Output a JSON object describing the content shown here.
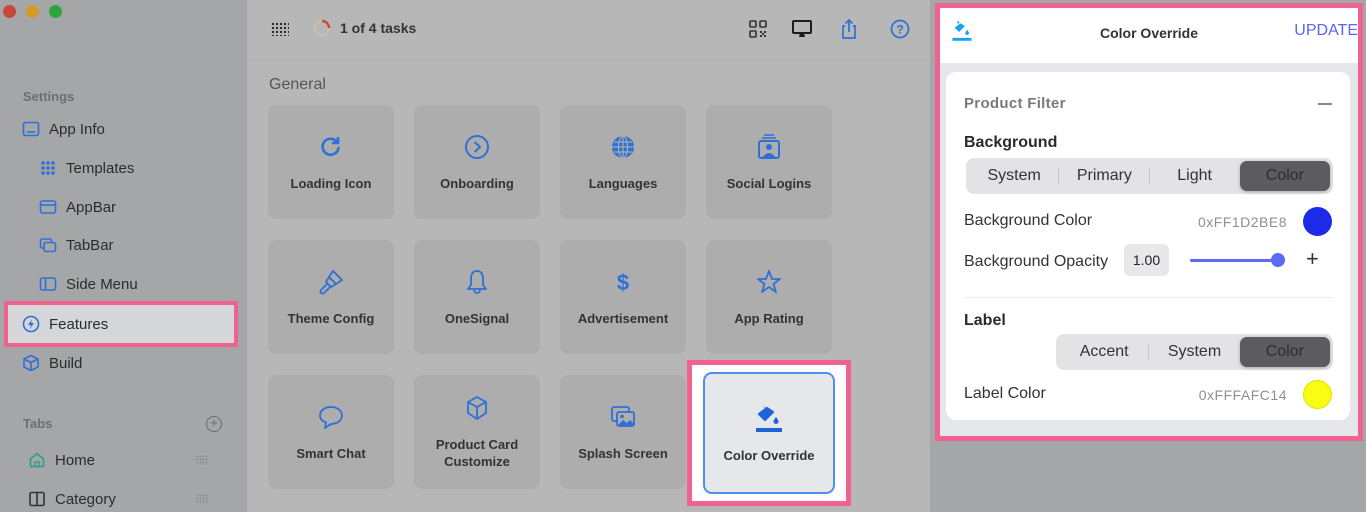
{
  "window": {
    "traffic_lights": [
      "close",
      "minimize",
      "zoom"
    ]
  },
  "sidebar": {
    "settings_label": "Settings",
    "items": [
      {
        "label": "App Info",
        "icon": "app-info-icon",
        "level": "top"
      },
      {
        "label": "Templates",
        "icon": "templates-icon",
        "level": "sub"
      },
      {
        "label": "AppBar",
        "icon": "appbar-icon",
        "level": "sub"
      },
      {
        "label": "TabBar",
        "icon": "tabbar-icon",
        "level": "sub"
      },
      {
        "label": "Side Menu",
        "icon": "side-menu-icon",
        "level": "sub"
      },
      {
        "label": "Features",
        "icon": "bolt-icon",
        "level": "top",
        "selected": true
      },
      {
        "label": "Build",
        "icon": "cube-icon",
        "level": "top"
      }
    ],
    "tabs_label": "Tabs",
    "tabs": [
      {
        "label": "Home",
        "icon": "home-icon"
      },
      {
        "label": "Category",
        "icon": "category-icon"
      }
    ]
  },
  "toolbar": {
    "tasks_text": "1 of 4 tasks",
    "tasks_progress": 0.25,
    "icons": [
      "qr-code-icon",
      "desktop-icon",
      "share-icon",
      "help-icon"
    ]
  },
  "main": {
    "section_title": "General",
    "tiles": [
      {
        "label": "Loading Icon",
        "icon": "refresh-icon"
      },
      {
        "label": "Onboarding",
        "icon": "chevron-circle-icon"
      },
      {
        "label": "Languages",
        "icon": "globe-icon"
      },
      {
        "label": "Social Logins",
        "icon": "contact-card-icon"
      },
      {
        "label": "Theme Config",
        "icon": "paintbrush-icon"
      },
      {
        "label": "OneSignal",
        "icon": "bell-icon"
      },
      {
        "label": "Advertisement",
        "icon": "dollar-icon"
      },
      {
        "label": "App Rating",
        "icon": "star-icon"
      },
      {
        "label": "Smart Chat",
        "icon": "chat-bubble-icon"
      },
      {
        "label": "Product Card Customize",
        "icon": "box-icon"
      },
      {
        "label": "Splash Screen",
        "icon": "photos-icon"
      },
      {
        "label": "Color Override",
        "icon": "paint-bucket-icon",
        "selected": true
      }
    ]
  },
  "panel": {
    "title": "Color Override",
    "update_label": "UPDATE",
    "section_title": "Product Filter",
    "background": {
      "heading": "Background",
      "options": [
        "System",
        "Primary",
        "Light",
        "Color"
      ],
      "selected": "Color",
      "color_label": "Background Color",
      "color_hex": "0xFF1D2BE8",
      "color_value": "#1d2be8",
      "opacity_label": "Background Opacity",
      "opacity_value": "1.00",
      "opacity_fraction": 1.0
    },
    "label": {
      "heading": "Label",
      "options": [
        "Accent",
        "System",
        "Color"
      ],
      "selected": "Color",
      "color_label": "Label Color",
      "color_hex": "0xFFFAFC14",
      "color_value": "#fafc14"
    }
  }
}
